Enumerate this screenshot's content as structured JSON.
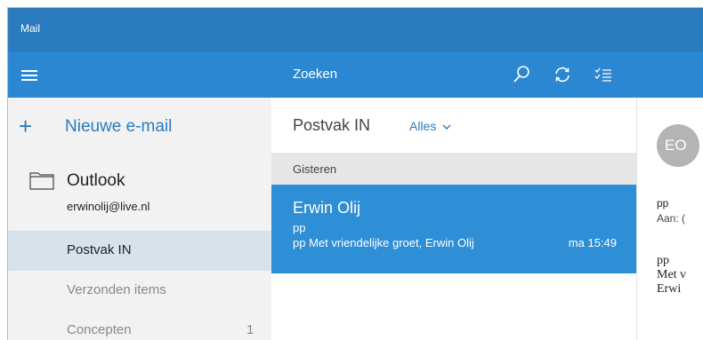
{
  "window": {
    "title": "Mail"
  },
  "toolbar": {
    "search_label": "Zoeken",
    "icons": [
      "search-icon",
      "sync-icon",
      "select-icon"
    ]
  },
  "sidebar": {
    "new_mail_label": "Nieuwe e-mail",
    "account_name": "Outlook",
    "account_email": "erwinolij@live.nl",
    "items": [
      {
        "label": "Postvak IN",
        "active": true
      },
      {
        "label": "Verzonden items",
        "active": false
      },
      {
        "label": "Concepten",
        "count": "1",
        "active": false
      }
    ]
  },
  "message_list": {
    "folder_title": "Postvak IN",
    "filter_label": "Alles",
    "group_header": "Gisteren",
    "messages": [
      {
        "from": "Erwin Olij",
        "subject": "pp",
        "preview": "pp Met vriendelijke groet, Erwin Olij",
        "time": "ma 15:49",
        "selected": true
      }
    ]
  },
  "reading_pane": {
    "avatar_initials": "EO",
    "subject": "pp",
    "to": "Aan: (",
    "body_lines": [
      "pp",
      "Met v",
      "Erwi"
    ]
  },
  "colors": {
    "titlebar": "#2b7bbf",
    "toolbar": "#2b87d1",
    "selected_message": "#2e8fd7",
    "active_nav": "#d8e2eb",
    "accent_text": "#2b7bbf"
  }
}
